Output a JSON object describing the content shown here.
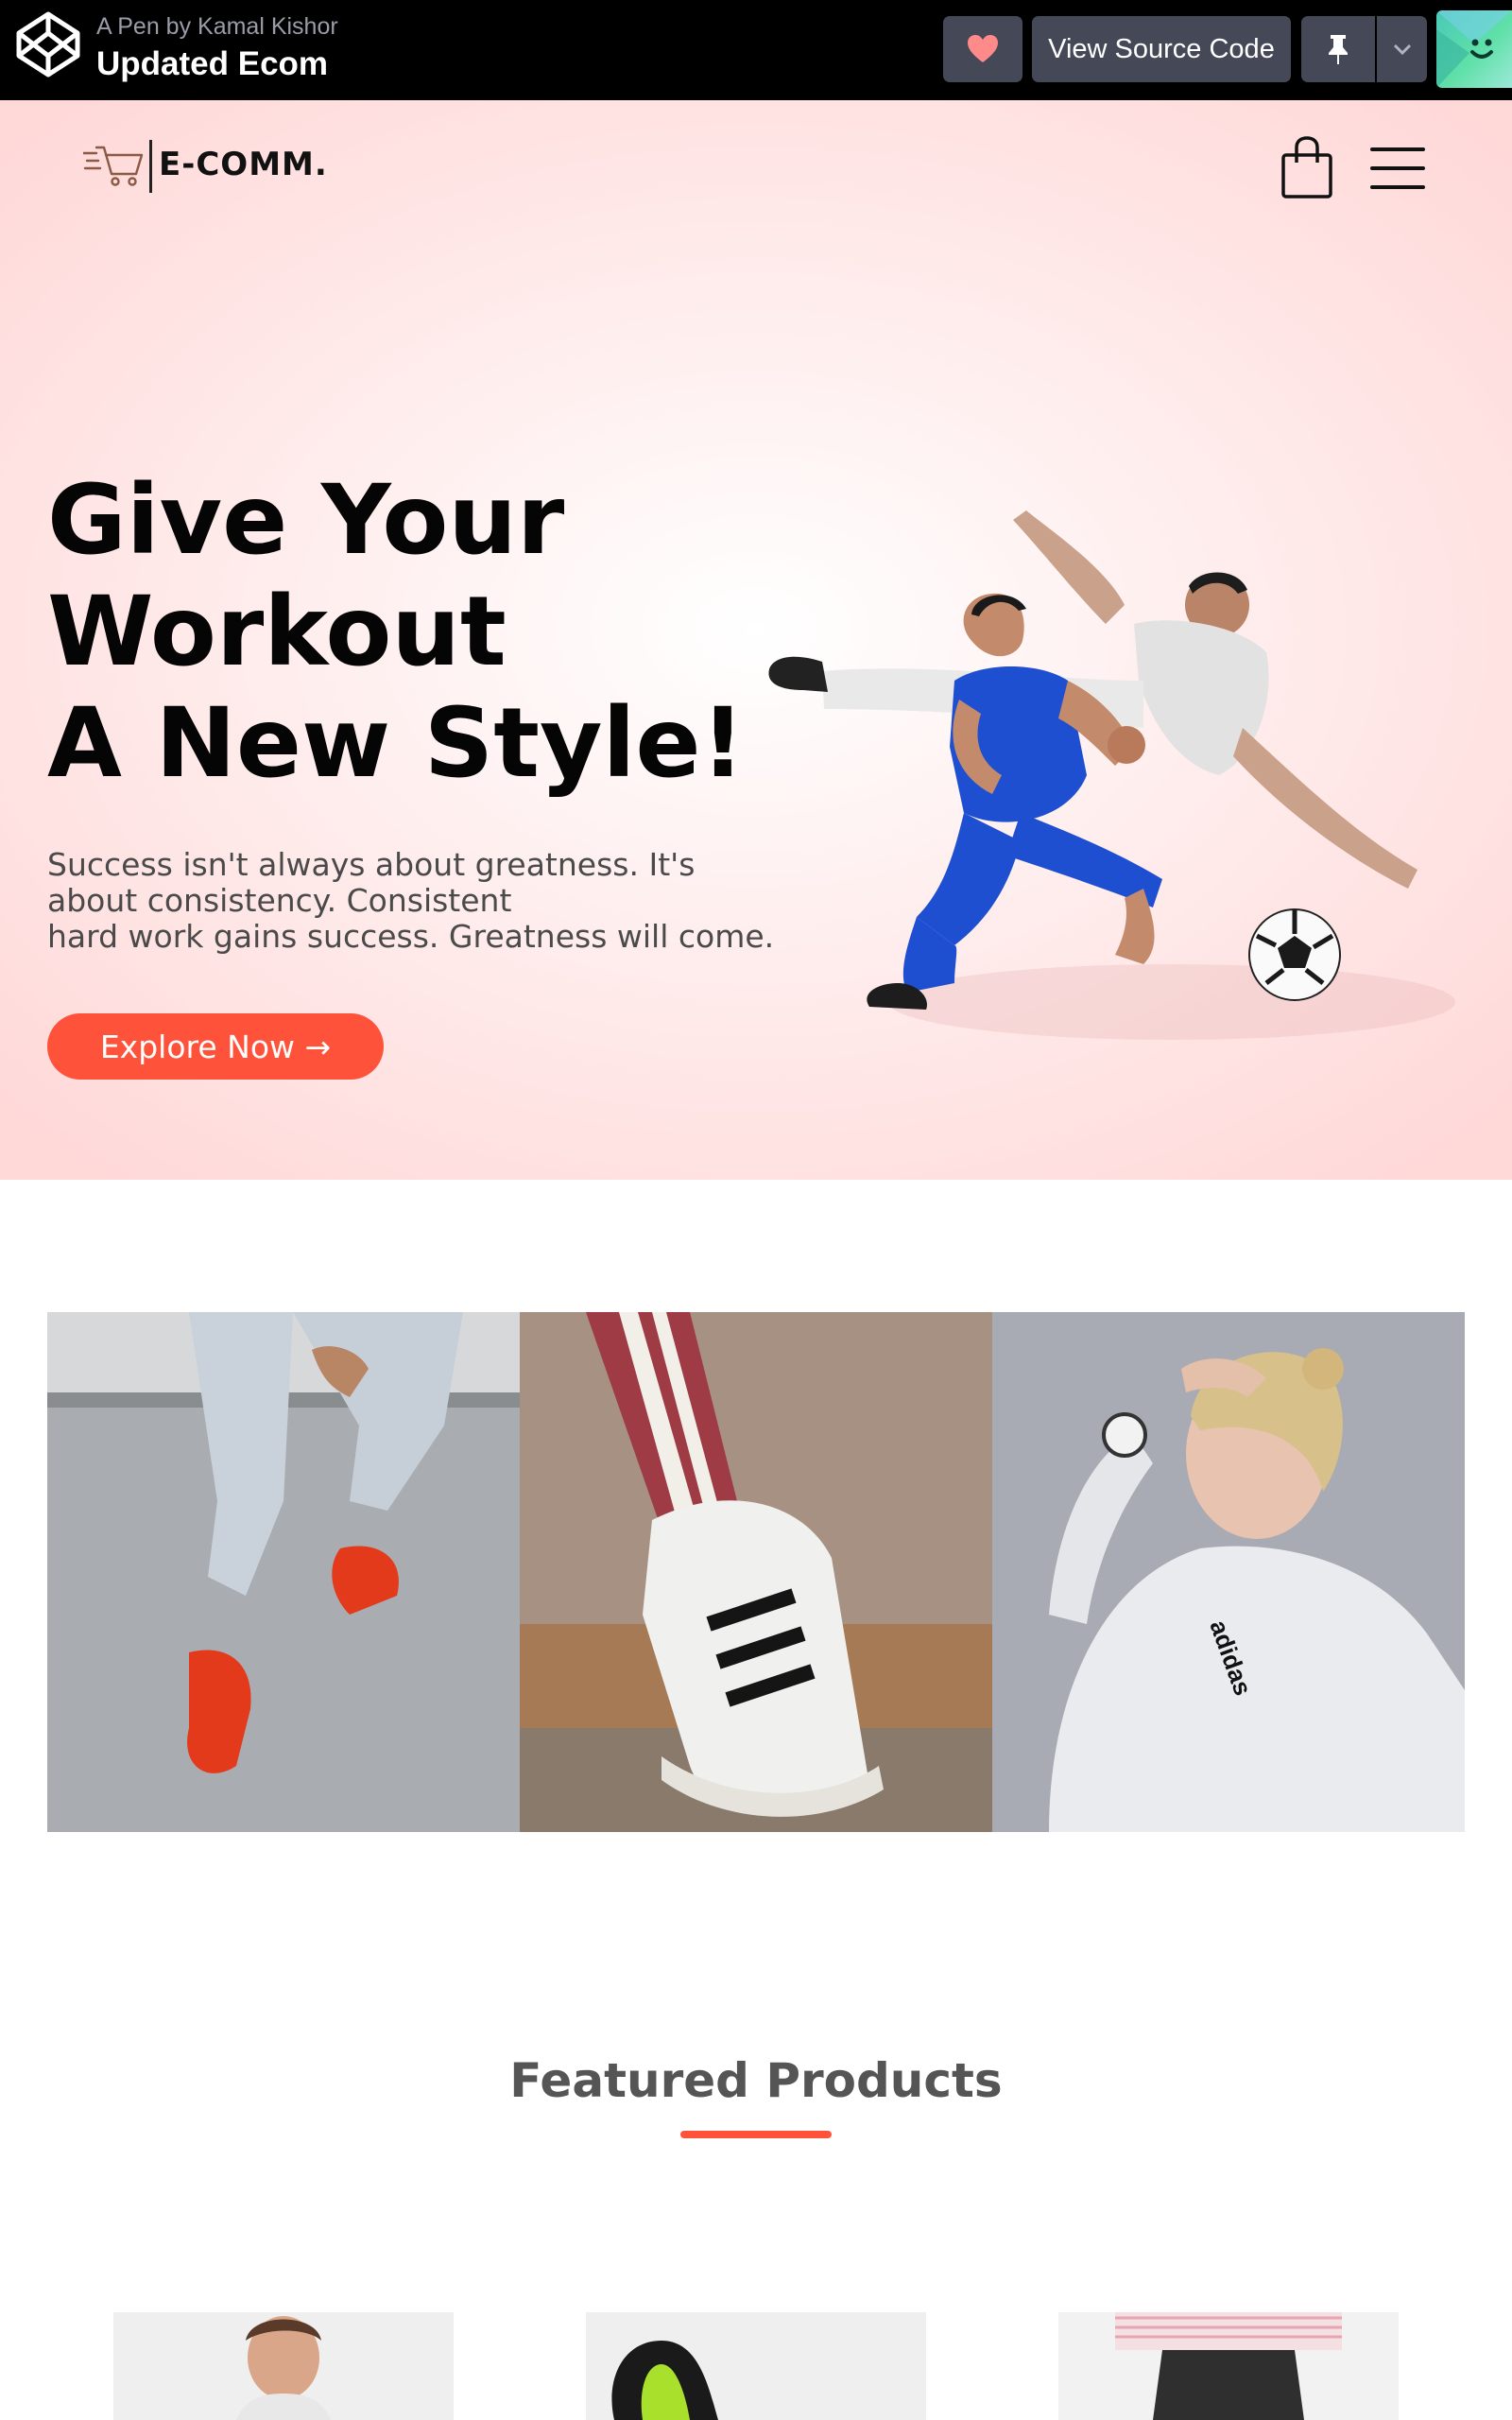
{
  "codepen": {
    "by_line": "A Pen by Kamal Kishor",
    "pen_title": "Updated Ecom",
    "view_source_label": "View Source Code"
  },
  "nav": {
    "brand": "E-COMM."
  },
  "hero": {
    "title_lines": [
      "Give Your",
      "Workout",
      "A New Style!"
    ],
    "text_lines": [
      "Success isn't always about greatness. It's",
      "about consistency. Consistent",
      "hard work gains success. Greatness will come."
    ],
    "cta_label": "Explore Now →"
  },
  "featured": {
    "title": "Featured Products"
  },
  "colors": {
    "accent": "#ff523b",
    "codepen_bar": "#000000",
    "codepen_button": "#444857"
  }
}
